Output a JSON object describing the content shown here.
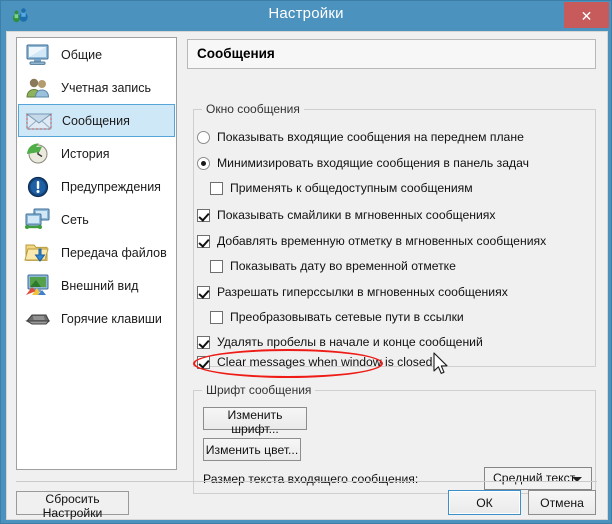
{
  "window": {
    "title": "Настройки",
    "icon": "app-icon",
    "close_label": "✕",
    "titlebar_color": "#4b92be",
    "close_color": "#c75b5b"
  },
  "sidebar": {
    "items": [
      {
        "label": "Общие",
        "icon": "monitor-icon",
        "selected": false
      },
      {
        "label": "Учетная запись",
        "icon": "users-icon",
        "selected": false
      },
      {
        "label": "Сообщения",
        "icon": "envelope-icon",
        "selected": true
      },
      {
        "label": "История",
        "icon": "clock-arrow-icon",
        "selected": false
      },
      {
        "label": "Предупреждения",
        "icon": "warning-circle-icon",
        "selected": false
      },
      {
        "label": "Сеть",
        "icon": "network-icon",
        "selected": false
      },
      {
        "label": "Передача файлов",
        "icon": "folder-download-icon",
        "selected": false
      },
      {
        "label": "Внешний вид",
        "icon": "appearance-icon",
        "selected": false
      },
      {
        "label": "Горячие клавиши",
        "icon": "keyboard-icon",
        "selected": false
      }
    ],
    "selected_color": "#cfe8f7",
    "selected_border": "#55a5d8"
  },
  "pane": {
    "title": "Сообщения"
  },
  "message_window_group": {
    "legend": "Окно сообщения",
    "options": [
      {
        "type": "radio",
        "label": "Показывать входящие сообщения на переднем плане",
        "checked": false,
        "indent": false
      },
      {
        "type": "radio",
        "label": "Минимизировать входящие сообщения в панель задач",
        "checked": true,
        "indent": false
      },
      {
        "type": "checkbox",
        "label": "Применять к общедоступным сообщениям",
        "checked": false,
        "indent": true
      },
      {
        "type": "checkbox",
        "label": "Показывать смайлики в мгновенных сообщениях",
        "checked": true,
        "indent": false
      },
      {
        "type": "checkbox",
        "label": "Добавлять временную отметку в мгновенных сообщениях",
        "checked": true,
        "indent": false
      },
      {
        "type": "checkbox",
        "label": "Показывать дату во временной отметке",
        "checked": false,
        "indent": true
      },
      {
        "type": "checkbox",
        "label": "Разрешать гиперссылки в мгновенных сообщениях",
        "checked": true,
        "indent": false
      },
      {
        "type": "checkbox",
        "label": "Преобразовывать сетевые пути в ссылки",
        "checked": false,
        "indent": true
      },
      {
        "type": "checkbox",
        "label": "Удалять пробелы в начале и конце сообщений",
        "checked": true,
        "indent": false
      },
      {
        "type": "checkbox",
        "label": "Clear messages when window is closed",
        "checked": true,
        "indent": false
      }
    ]
  },
  "font_group": {
    "legend": "Шрифт сообщения",
    "change_font_label": "Изменить шрифт...",
    "change_color_label": "Изменить цвет...",
    "text_size_label": "Размер текста входящего сообщения:",
    "text_size_value": "Средний текст"
  },
  "footer": {
    "reset_label": "Сбросить Настройки",
    "ok_label": "ОК",
    "cancel_label": "Отмена"
  },
  "annotation": {
    "highlight_color": "#ee1b16",
    "target": "Clear messages when window is closed"
  }
}
